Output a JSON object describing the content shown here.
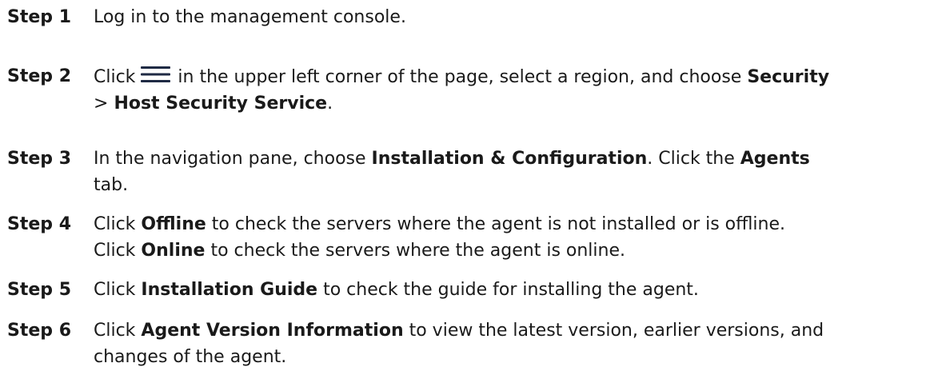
{
  "steps": [
    {
      "label": "Step 1",
      "lines": [
        [
          {
            "t": "Log in to the management console."
          }
        ]
      ]
    },
    {
      "label": "Step 2",
      "lines": [
        [
          {
            "t": "Click "
          },
          {
            "icon": "menu-icon"
          },
          {
            "t": " in the upper left corner of the page, select a region, and choose "
          },
          {
            "t": "Security",
            "b": true
          }
        ],
        [
          {
            "t": "> "
          },
          {
            "t": "Host Security Service",
            "b": true
          },
          {
            "t": "."
          }
        ]
      ]
    },
    {
      "label": "Step 3",
      "lines": [
        [
          {
            "t": "In the navigation pane, choose "
          },
          {
            "t": "Installation & Configuration",
            "b": true
          },
          {
            "t": ". Click the "
          },
          {
            "t": "Agents",
            "b": true
          }
        ],
        [
          {
            "t": "tab."
          }
        ]
      ]
    },
    {
      "label": "Step 4",
      "lines": [
        [
          {
            "t": "Click "
          },
          {
            "t": "Offline",
            "b": true
          },
          {
            "t": " to check the servers where the agent is not installed or is offline."
          }
        ],
        [
          {
            "t": "Click "
          },
          {
            "t": "Online",
            "b": true
          },
          {
            "t": " to check the servers where the agent is online."
          }
        ]
      ]
    },
    {
      "label": "Step 5",
      "lines": [
        [
          {
            "t": "Click "
          },
          {
            "t": "Installation Guide",
            "b": true
          },
          {
            "t": " to check the guide for installing the agent."
          }
        ]
      ]
    },
    {
      "label": "Step 6",
      "lines": [
        [
          {
            "t": "Click "
          },
          {
            "t": "Agent Version Information",
            "b": true
          },
          {
            "t": " to view the latest version, earlier versions, and"
          }
        ],
        [
          {
            "t": "changes of the agent."
          }
        ]
      ]
    }
  ],
  "colors": {
    "text": "#1a1a1a",
    "icon": "#1f2a44"
  }
}
